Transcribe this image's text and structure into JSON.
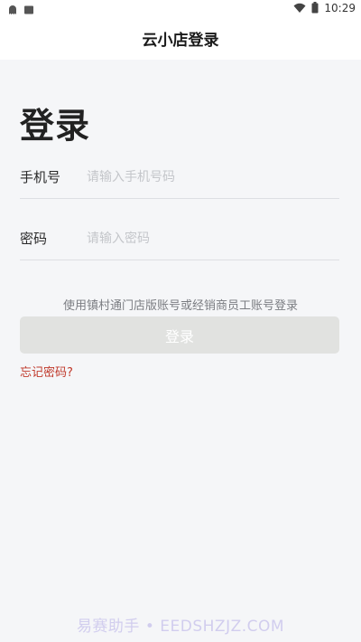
{
  "status_bar": {
    "time": "10:29",
    "icons": [
      "ghost-notification-icon",
      "square-notification-icon",
      "wifi-icon",
      "battery-icon"
    ]
  },
  "header": {
    "title": "云小店登录"
  },
  "main": {
    "heading": "登录",
    "phone": {
      "label": "手机号",
      "placeholder": "请输入手机号码",
      "value": ""
    },
    "password": {
      "label": "密码",
      "placeholder": "请输入密码",
      "value": ""
    },
    "hint": "使用镇村通门店版账号或经销商员工账号登录",
    "login_button_label": "登录",
    "forgot_password_label": "忘记密码?"
  },
  "watermark": {
    "text": "易赛助手 • EEDSHZJZ.COM"
  },
  "colors": {
    "background": "#f5f6f8",
    "button_disabled": "#e1e2e0",
    "link": "#c0392b",
    "divider": "#dddfe3"
  }
}
